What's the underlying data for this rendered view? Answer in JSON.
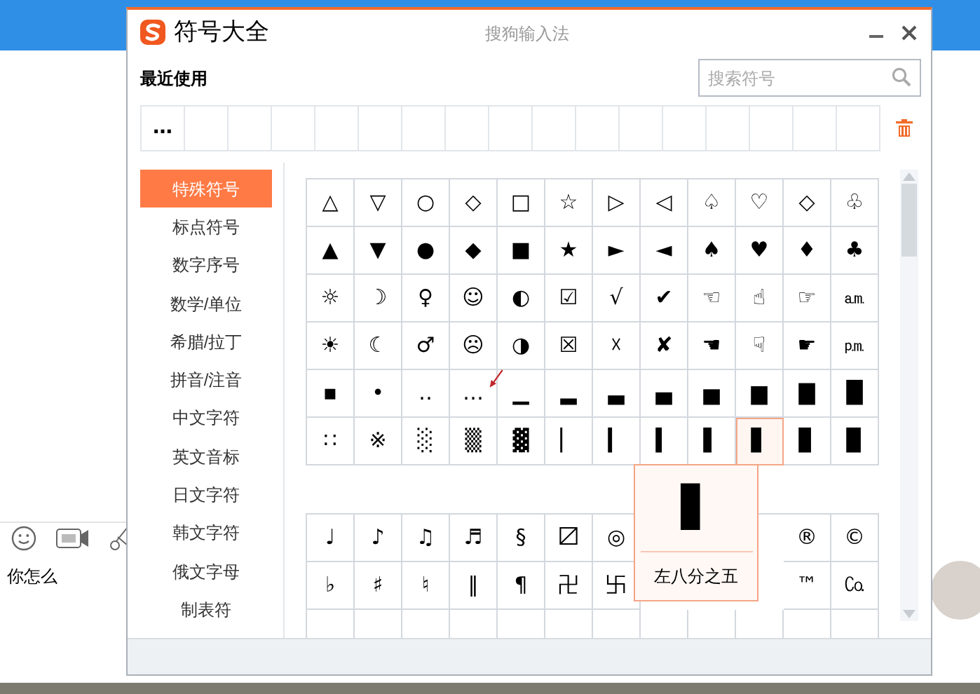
{
  "chat": {
    "message": "你怎么"
  },
  "dialog": {
    "title": "符号大全",
    "app_name": "搜狗输入法"
  },
  "recent": {
    "label": "最近使用",
    "symbols": [
      "…"
    ]
  },
  "search": {
    "placeholder": "搜索符号"
  },
  "categories": [
    {
      "label": "特殊符号",
      "selected": true
    },
    {
      "label": "标点符号",
      "selected": false
    },
    {
      "label": "数字序号",
      "selected": false
    },
    {
      "label": "数学/单位",
      "selected": false
    },
    {
      "label": "希腊/拉丁",
      "selected": false
    },
    {
      "label": "拼音/注音",
      "selected": false
    },
    {
      "label": "中文字符",
      "selected": false
    },
    {
      "label": "英文音标",
      "selected": false
    },
    {
      "label": "日文字符",
      "selected": false
    },
    {
      "label": "韩文字符",
      "selected": false
    },
    {
      "label": "俄文字母",
      "selected": false
    },
    {
      "label": "制表符",
      "selected": false
    }
  ],
  "symbol_grid": [
    [
      {
        "symbol": "△",
        "selected": false
      },
      {
        "symbol": "▽",
        "selected": false
      },
      {
        "symbol": "○",
        "selected": false
      },
      {
        "symbol": "◇",
        "selected": false
      },
      {
        "symbol": "□",
        "selected": false
      },
      {
        "symbol": "☆",
        "selected": false
      },
      {
        "symbol": "▷",
        "selected": false
      },
      {
        "symbol": "◁",
        "selected": false
      },
      {
        "symbol": "♤",
        "selected": false
      },
      {
        "symbol": "♡",
        "selected": false
      },
      {
        "symbol": "◇",
        "selected": false
      },
      {
        "symbol": "♧",
        "selected": false
      }
    ],
    [
      {
        "symbol": "▲",
        "selected": false
      },
      {
        "symbol": "▼",
        "selected": false
      },
      {
        "symbol": "●",
        "selected": false
      },
      {
        "symbol": "◆",
        "selected": false
      },
      {
        "symbol": "■",
        "selected": false
      },
      {
        "symbol": "★",
        "selected": false
      },
      {
        "symbol": "►",
        "selected": false
      },
      {
        "symbol": "◄",
        "selected": false
      },
      {
        "symbol": "♠",
        "selected": false
      },
      {
        "symbol": "♥",
        "selected": false
      },
      {
        "symbol": "♦",
        "selected": false
      },
      {
        "symbol": "♣",
        "selected": false
      }
    ],
    [
      {
        "symbol": "☼",
        "selected": false
      },
      {
        "symbol": "☽",
        "selected": false
      },
      {
        "symbol": "♀",
        "selected": false
      },
      {
        "symbol": "☺",
        "selected": false
      },
      {
        "symbol": "◐",
        "selected": false
      },
      {
        "symbol": "☑",
        "selected": false
      },
      {
        "symbol": "√",
        "selected": false
      },
      {
        "symbol": "✔",
        "selected": false
      },
      {
        "symbol": "☜",
        "selected": false
      },
      {
        "symbol": "☝",
        "selected": false
      },
      {
        "symbol": "☞",
        "selected": false
      },
      {
        "symbol": "㏂",
        "selected": false
      }
    ],
    [
      {
        "symbol": "☀",
        "selected": false
      },
      {
        "symbol": "☾",
        "selected": false
      },
      {
        "symbol": "♂",
        "selected": false
      },
      {
        "symbol": "☹",
        "selected": false
      },
      {
        "symbol": "◑",
        "selected": false
      },
      {
        "symbol": "☒",
        "selected": false
      },
      {
        "symbol": "☓",
        "selected": false
      },
      {
        "symbol": "✘",
        "selected": false
      },
      {
        "symbol": "☚",
        "selected": false
      },
      {
        "symbol": "☟",
        "selected": false
      },
      {
        "symbol": "☛",
        "selected": false
      },
      {
        "symbol": "㏘",
        "selected": false
      }
    ],
    [
      {
        "symbol": "▪",
        "selected": false
      },
      {
        "symbol": "•",
        "selected": false
      },
      {
        "symbol": "‥",
        "selected": false
      },
      {
        "symbol": "…",
        "selected": false
      },
      {
        "symbol": "▁",
        "selected": false
      },
      {
        "symbol": "▂",
        "selected": false
      },
      {
        "symbol": "▃",
        "selected": false
      },
      {
        "symbol": "▄",
        "selected": false
      },
      {
        "symbol": "▅",
        "selected": false
      },
      {
        "symbol": "▆",
        "selected": false
      },
      {
        "symbol": "▇",
        "selected": false
      },
      {
        "symbol": "█",
        "selected": false
      }
    ],
    [
      {
        "symbol": "∷",
        "selected": false
      },
      {
        "symbol": "※",
        "selected": false
      },
      {
        "symbol": "░",
        "selected": false
      },
      {
        "symbol": "▒",
        "selected": false
      },
      {
        "symbol": "▓",
        "selected": false
      },
      {
        "symbol": "▏",
        "selected": false
      },
      {
        "symbol": "▎",
        "selected": false
      },
      {
        "symbol": "▍",
        "selected": false
      },
      {
        "symbol": "▌",
        "selected": false
      },
      {
        "symbol": "▋",
        "selected": true
      },
      {
        "symbol": "▊",
        "selected": false
      },
      {
        "symbol": "▉",
        "selected": false
      }
    ]
  ],
  "tooltip": {
    "symbol": "▋",
    "name": "左八分之五"
  },
  "symbol_grid_2": [
    {
      "left": [
        "♩",
        "♪",
        "♫",
        "♬",
        "§",
        "〼",
        "◎"
      ],
      "right": [
        "®",
        "©"
      ]
    },
    {
      "left": [
        "♭",
        "♯",
        "♮",
        "‖",
        "¶",
        "卍",
        "卐"
      ],
      "right": [
        "™",
        "㏇"
      ]
    }
  ]
}
